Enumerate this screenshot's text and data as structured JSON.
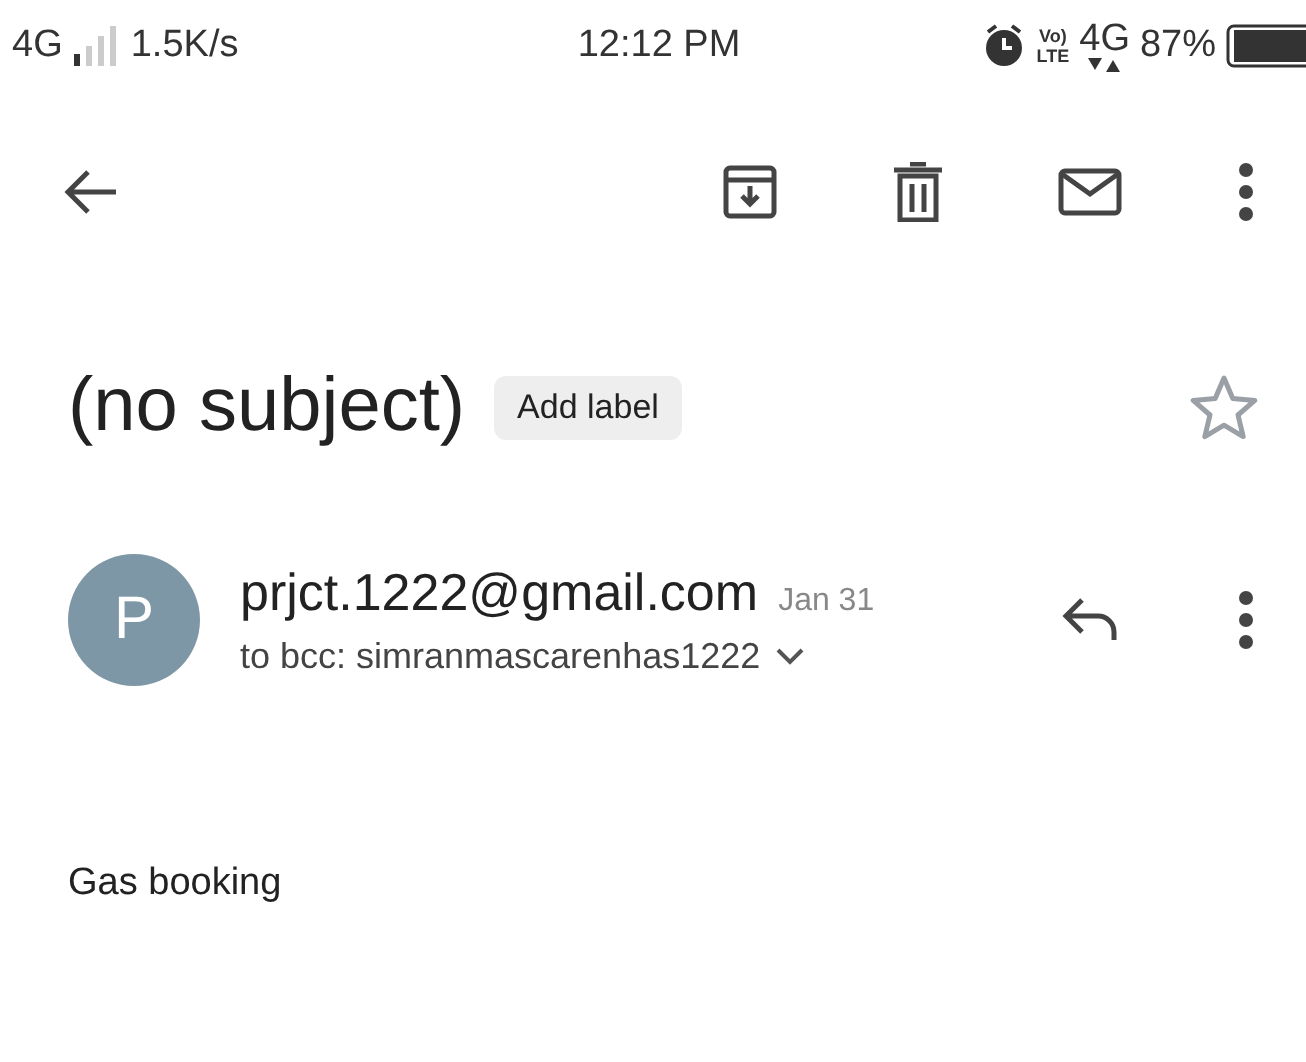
{
  "status_bar": {
    "network": "4G",
    "speed": "1.5K/s",
    "time": "12:12 PM",
    "volte_top": "Vo)",
    "volte_bottom": "LTE",
    "data_network": "4G",
    "battery": "87%"
  },
  "toolbar": {
    "actions": [
      {
        "kind": "archive"
      },
      {
        "kind": "delete"
      },
      {
        "kind": "mail"
      },
      {
        "kind": "more"
      }
    ]
  },
  "message": {
    "subject": "(no subject)",
    "add_label": "Add label",
    "starred": false,
    "sender": {
      "avatar": "P",
      "email": "prjct.1222@gmail.com",
      "date": "Jan 31",
      "recipients": "to bcc: simranmascarenhas1222"
    },
    "body": "Gas booking"
  }
}
